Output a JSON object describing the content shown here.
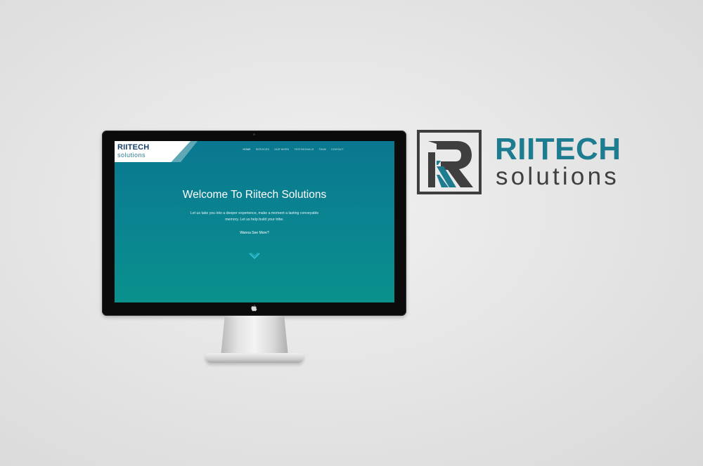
{
  "website": {
    "logo": {
      "name": "RIITECH",
      "sub": "solutions"
    },
    "nav": [
      "HOME",
      "SERVICES",
      "OUR WORK",
      "TESTIMONIALS",
      "TEAM",
      "CONTACT"
    ],
    "hero": {
      "title": "Welcome To Riitech Solutions",
      "subtitle": "Let us take you into a deeper experience, make a moment a lasting conveyable memory. Let us help build your tribe.",
      "cta": "Wanna See More?"
    }
  },
  "brand": {
    "name": "RIITECH",
    "tagline": "solutions",
    "colors": {
      "teal": "#1e7c91",
      "dark": "#3f3f3f"
    }
  },
  "icons": {
    "scroll": "chevron-down-icon",
    "device": "apple-logo-icon"
  }
}
